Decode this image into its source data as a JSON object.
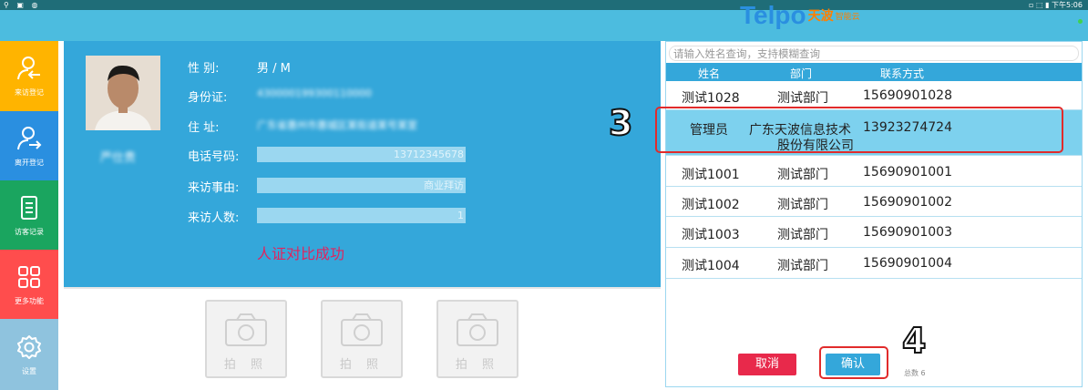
{
  "status_bar": {
    "left_icons": "⚲ ▣ ◍",
    "right_text": "▫ ⬚ ▮ 下午5:06"
  },
  "logo": {
    "brand": "Telpo",
    "cn": "天波",
    "sub": "智能云"
  },
  "sidebar": {
    "items": [
      {
        "label": "来访登记",
        "icon": "visitor-register-icon",
        "color": "#ffb400"
      },
      {
        "label": "离开登记",
        "icon": "leave-register-icon",
        "color": "#2a8fe0"
      },
      {
        "label": "访客记录",
        "icon": "visitor-records-icon",
        "color": "#1aa55f"
      },
      {
        "label": "更多功能",
        "icon": "more-functions-icon",
        "color": "#ff4d4d"
      },
      {
        "label": "设置",
        "icon": "settings-icon",
        "color": "#8fc3de"
      }
    ]
  },
  "profile": {
    "name": "严仕贵",
    "gender_label": "性  别:",
    "gender_value": "男 / M",
    "id_label": "身份证:",
    "id_value": "430000199300110000",
    "address_label": "住  址:",
    "address_value": "广东省惠州市惠城区某街道某号某室",
    "phone_label": "电话号码:",
    "phone_value": "13712345678",
    "reason_label": "来访事由:",
    "reason_value": "商业拜访",
    "count_label": "来访人数:",
    "count_value": "1",
    "success_text": "人证对比成功"
  },
  "camera_slots": [
    {
      "label": "拍 照"
    },
    {
      "label": "拍 照"
    },
    {
      "label": "拍 照"
    }
  ],
  "contacts": {
    "search_placeholder": "请输入姓名查询，支持模糊查询",
    "columns": [
      "姓名",
      "部门",
      "联系方式"
    ],
    "rows": [
      {
        "name": "测试1028",
        "dept": "测试部门",
        "phone": "15690901028"
      },
      {
        "name": "管理员",
        "dept_line1": "广东天波信息技术",
        "dept_line2": "股份有限公司",
        "phone": "13923274724"
      },
      {
        "name": "测试1001",
        "dept": "测试部门",
        "phone": "15690901001"
      },
      {
        "name": "测试1002",
        "dept": "测试部门",
        "phone": "15690901002"
      },
      {
        "name": "测试1003",
        "dept": "测试部门",
        "phone": "15690901003"
      },
      {
        "name": "测试1004",
        "dept": "测试部门",
        "phone": "15690901004"
      }
    ],
    "cancel_label": "取消",
    "confirm_label": "确认",
    "total_text": "总数  6"
  },
  "annotations": {
    "step3": "3",
    "step4": "4"
  },
  "colors": {
    "accent": "#34a7da",
    "success": "#e0245e",
    "cancel": "#e8294b"
  }
}
